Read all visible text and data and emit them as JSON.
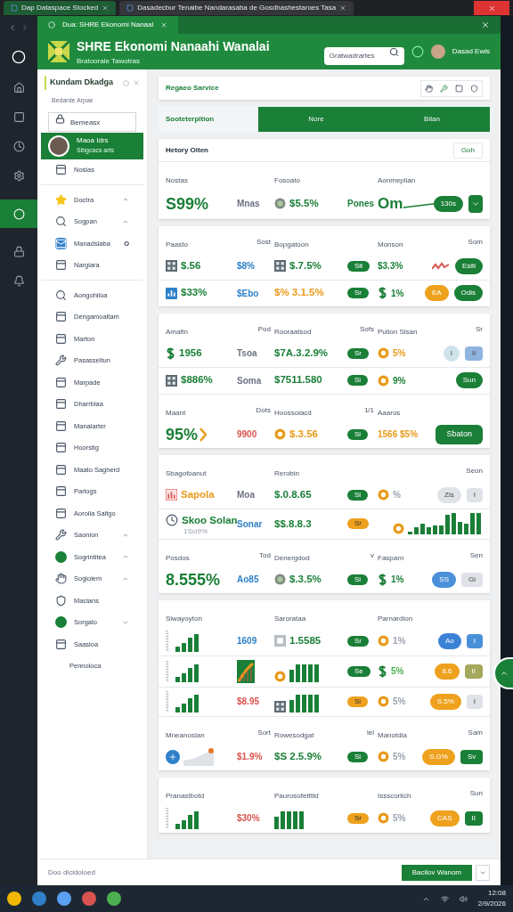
{
  "browser": {
    "tabs": [
      {
        "label": "Dap Dataspace Stocked",
        "selected": true
      },
      {
        "label": "Dasadecbur Tenaibe Nandarasaba de Gosdhashestaroes Tasa",
        "selected": false
      }
    ]
  },
  "window": {
    "tab": "Dua: SHRE Ekonomi Nanaal",
    "title": "SHRE Ekonomi Nanaahi Wanalai",
    "subtitle": "Bratoorale Tawotras",
    "search": {
      "placeholder": "Gratwadrartes"
    },
    "user": "Dasad Ewis"
  },
  "sidebar": {
    "title": "Kundam Dkadga",
    "section": "Bedarde Arpae",
    "search": {
      "value": "Bemeasx"
    },
    "profile": {
      "name": "Maoa Idrs",
      "detail": "Sibgcacs arts",
      "selected": true
    },
    "items": [
      {
        "kind": "panel",
        "label": "Nosias"
      },
      {
        "kind": "divider"
      },
      {
        "kind": "star",
        "label": "Doctra",
        "expanded": true
      },
      {
        "kind": "search",
        "label": "Sogpan",
        "expanded": true
      },
      {
        "kind": "mail",
        "label": "Manadsiaba",
        "badge": "O"
      },
      {
        "kind": "panel",
        "label": "Nargiara"
      },
      {
        "kind": "divider"
      },
      {
        "kind": "search",
        "label": "Aongohiloa"
      },
      {
        "kind": "panel",
        "label": "Dengamoaltam"
      },
      {
        "kind": "panel",
        "label": "Marton"
      },
      {
        "kind": "tool",
        "label": "Pasasseltun"
      },
      {
        "kind": "panel",
        "label": "Marpade"
      },
      {
        "kind": "panel",
        "label": "Dharrblaa"
      },
      {
        "kind": "panel",
        "label": "Manalarter"
      },
      {
        "kind": "panel",
        "label": "Hoorstig"
      },
      {
        "kind": "panel",
        "label": "Maato Sagherd"
      },
      {
        "kind": "panel",
        "label": "Parlogs"
      },
      {
        "kind": "panel",
        "label": "Aoroila Saltgo"
      },
      {
        "kind": "tool",
        "label": "Saonion",
        "expanded": true
      },
      {
        "kind": "dot",
        "label": "Sogrintitea",
        "expanded": true
      },
      {
        "kind": "hand",
        "label": "Sogioiem",
        "expanded": true
      },
      {
        "kind": "shield",
        "label": "Macians"
      },
      {
        "kind": "dot",
        "label": "Sorgalo",
        "expanded": false
      },
      {
        "kind": "panel",
        "label": "Saasloa"
      },
      {
        "kind": "plain",
        "label": "Pennoloca"
      }
    ]
  },
  "toolbar": {
    "title": "Regaeo Sarvice"
  },
  "tabs": [
    {
      "label": "Sooteterpition",
      "selected": true
    },
    {
      "label": "Nore",
      "selected": false
    },
    {
      "label": "Bilan",
      "selected": false
    }
  ],
  "cards": [
    {
      "title": "Hetory Oiten",
      "action": "Goh",
      "groups": [
        {
          "headers": {
            "column_1": "Nostas",
            "column_3": "Fosoato",
            "column_5": "Aonmeplian"
          },
          "rows": [
            [
              {
                "kind": "headline",
                "text": "S99%",
                "color": "#1a7f37"
              },
              {
                "kind": "value",
                "text": "Mnas",
                "color": "#6b7280"
              },
              {
                "kind": "value",
                "text": "$5.5%",
                "color": "#1a7f37",
                "marker": {
                  "kind": "coin"
                }
              },
              {
                "kind": "value",
                "text": "Pones",
                "color": "#1a7f37"
              },
              {
                "kind": "trend",
                "text": "Om",
                "color": "#1a7f37"
              },
              {
                "kind": "pills",
                "items": [
                  {
                    "kind": "pill",
                    "text": "130s",
                    "color": "#1a7f37"
                  },
                  {
                    "kind": "menu"
                  }
                ]
              }
            ]
          ]
        }
      ]
    },
    {
      "groups": [
        {
          "headers": {
            "column_1": "Paasto",
            "column_2": "Sost",
            "column_3": "Bopgatoon",
            "column_5": "Monson",
            "column_6": "Som"
          },
          "rows": [
            [
              {
                "kind": "value",
                "text": "$.56",
                "color": "#1a7f37",
                "marker": {
                  "kind": "tile"
                }
              },
              {
                "kind": "value",
                "text": "$8%",
                "color": "#2f80c9"
              },
              {
                "kind": "value",
                "text": "$.7.5%",
                "color": "#1a7f37",
                "marker": {
                  "kind": "tile"
                }
              },
              {
                "kind": "pill",
                "text": "Sit",
                "color": "#1a7f37"
              },
              {
                "kind": "value",
                "text": "$3.3%",
                "color": "#1a7f37"
              },
              {
                "kind": "pills",
                "items": [
                  {
                    "kind": "squiggle"
                  },
                  {
                    "kind": "pill",
                    "text": "Esiti",
                    "color": "#1a7f37"
                  }
                ]
              }
            ],
            [
              {
                "kind": "value",
                "text": "$33%",
                "color": "#1a7f37",
                "marker": {
                  "kind": "blue-tile"
                }
              },
              {
                "kind": "value",
                "text": "$Ebo",
                "color": "#2f80c9"
              },
              {
                "kind": "value",
                "text": "$% 3.1.5%",
                "color": "#e89a1a"
              },
              {
                "kind": "pill",
                "text": "Sr",
                "color": "#1a7f37"
              },
              {
                "kind": "value",
                "text": "1%",
                "color": "#1a7f37",
                "marker": {
                  "kind": "dollar"
                }
              },
              {
                "kind": "pills",
                "items": [
                  {
                    "kind": "pill",
                    "text": "EA",
                    "color": "#eea11d"
                  },
                  {
                    "kind": "pill",
                    "text": "Odis",
                    "color": "#1a7f37"
                  }
                ]
              }
            ]
          ]
        }
      ]
    },
    {
      "groups": [
        {
          "headers": {
            "column_1": "Amafin",
            "column_2": "Pod",
            "column_3": "Rooraatsod",
            "column_4": "Sofs",
            "column_5": "Pullon Sisan",
            "column_6": "Sr"
          },
          "rows": [
            [
              {
                "kind": "value",
                "text": "1956",
                "color": "#1a7f37",
                "marker": {
                  "kind": "dollar"
                }
              },
              {
                "kind": "value",
                "text": "Tsoa",
                "color": "#6b7280"
              },
              {
                "kind": "value",
                "text": "$7A.3.2.9%",
                "color": "#1a7f37"
              },
              {
                "kind": "pill",
                "text": "Sr",
                "color": "#1a7f37"
              },
              {
                "kind": "value",
                "text": "5%",
                "color": "#e89a1a",
                "marker": {
                  "kind": "coin-orange"
                }
              },
              {
                "kind": "pills",
                "items": [
                  {
                    "kind": "pill",
                    "text": "I",
                    "color": "#cfe3ea"
                  },
                  {
                    "kind": "tag",
                    "text": "Ii",
                    "color": "#8fb4e0"
                  }
                ]
              }
            ],
            [
              {
                "kind": "value",
                "text": "$886%",
                "color": "#1a7f37",
                "marker": {
                  "kind": "tile"
                }
              },
              {
                "kind": "value",
                "text": "Soma",
                "color": "#6b7280"
              },
              {
                "kind": "value",
                "text": "$7511.580",
                "color": "#1a7f37"
              },
              {
                "kind": "pill",
                "text": "Si",
                "color": "#1a7f37"
              },
              {
                "kind": "value",
                "text": "9%",
                "color": "#1a7f37",
                "marker": {
                  "kind": "coin-orange"
                }
              },
              {
                "kind": "pills",
                "items": [
                  {
                    "kind": "pill",
                    "text": "Sun",
                    "color": "#1a7f37"
                  }
                ]
              }
            ]
          ]
        },
        {
          "headers": {
            "column_1": "Maant",
            "column_2": "Dots",
            "column_3": "Hoossoiacd",
            "column_4": "1/1",
            "column_5": "Aaaros"
          },
          "rows": [
            [
              {
                "kind": "headline",
                "text": "95%",
                "color": "#1a7f37",
                "marker": {
                  "kind": "chevron"
                }
              },
              {
                "kind": "value",
                "text": "9900",
                "color": "#d9534f"
              },
              {
                "kind": "value",
                "text": "$.3.56",
                "color": "#e89a1a",
                "marker": {
                  "kind": "coin-orange"
                }
              },
              {
                "kind": "pill",
                "text": "Si",
                "color": "#1a7f37"
              },
              {
                "kind": "value",
                "text": "1566 $5%",
                "color": "#e89a1a"
              },
              {
                "kind": "pills",
                "items": [
                  {
                    "kind": "button",
                    "text": "Sbaton",
                    "color": "#1a7f37"
                  }
                ]
              }
            ]
          ]
        }
      ]
    },
    {
      "groups": [
        {
          "headers": {
            "column_1": "Sbagofoanut",
            "column_3": "Rerobin",
            "column_6": "Seon"
          },
          "rows": [
            [
              {
                "kind": "value",
                "text": "Sapola",
                "color": "#e89a1a",
                "marker": {
                  "kind": "red-tile"
                }
              },
              {
                "kind": "value",
                "text": "Moa",
                "color": "#6b7280"
              },
              {
                "kind": "value",
                "text": "$.0.8.65",
                "color": "#1a7f37"
              },
              {
                "kind": "pill",
                "text": "Si",
                "color": "#1a7f37"
              },
              {
                "kind": "value",
                "text": "%",
                "color": "#9ca3af",
                "marker": {
                  "kind": "coin-orange"
                }
              },
              {
                "kind": "pills",
                "items": [
                  {
                    "kind": "pill",
                    "text": "Zis",
                    "color": "#dfe3e8"
                  },
                  {
                    "kind": "tag",
                    "text": "I",
                    "color": "#dfe3e8"
                  }
                ]
              }
            ],
            [
              {
                "kind": "value",
                "text": "Skoo Solan",
                "detail": "1Sci9%",
                "color": "#1a7f37",
                "marker": {
                  "kind": "clock"
                }
              },
              {
                "kind": "value",
                "text": "Sonar",
                "color": "#2f80c9"
              },
              {
                "kind": "value",
                "text": "$$.8.8.3",
                "color": "#1a7f37"
              },
              {
                "kind": "pill",
                "text": "Sr",
                "color": "#eea11d"
              },
              {
                "kind": "bars",
                "marker": {
                  "kind": "coin-orange"
                }
              }
            ]
          ]
        },
        {
          "headers": {
            "column_1": "Posdos",
            "column_2": "Tod",
            "column_3": "Denergdod",
            "column_4": "v",
            "column_5": "Fasparn",
            "column_6": "Sen"
          },
          "rows": [
            [
              {
                "kind": "headline",
                "text": "8.555%",
                "color": "#1a7f37"
              },
              {
                "kind": "value",
                "text": "Ao85",
                "color": "#2f80c9"
              },
              {
                "kind": "value",
                "text": "$.3.5%",
                "color": "#1a7f37",
                "marker": {
                  "kind": "coin"
                }
              },
              {
                "kind": "pill",
                "text": "Si",
                "color": "#1a7f37"
              },
              {
                "kind": "value",
                "text": "1%",
                "color": "#1a7f37",
                "marker": {
                  "kind": "dollar"
                }
              },
              {
                "kind": "pills",
                "items": [
                  {
                    "kind": "pill",
                    "text": "SS",
                    "color": "#4a90d9"
                  },
                  {
                    "kind": "tag",
                    "text": "Gi",
                    "color": "#dfe3e8"
                  }
                ]
              }
            ]
          ]
        }
      ]
    },
    {
      "groups": [
        {
          "headers": {
            "column_1": "Siwayoyton",
            "column_3": "Sarorataa",
            "column_5": "Parnardion"
          },
          "rows": [
            [
              {
                "kind": "axis-bars"
              },
              {
                "kind": "value",
                "text": "1609",
                "color": "#2f80c9"
              },
              {
                "kind": "value",
                "text": "1.5585",
                "color": "#1a7f37",
                "marker": {
                  "kind": "grey-tile"
                }
              },
              {
                "kind": "pill",
                "text": "Sr",
                "color": "#1a7f37"
              },
              {
                "kind": "value",
                "text": "1%",
                "color": "#9ca3af",
                "marker": {
                  "kind": "coin-orange"
                }
              },
              {
                "kind": "pills",
                "items": [
                  {
                    "kind": "pill",
                    "text": "Ao",
                    "color": "#3b82d6"
                  },
                  {
                    "kind": "tag",
                    "text": "I",
                    "color": "#4a90d9"
                  }
                ]
              }
            ],
            [
              {
                "kind": "axis-bars"
              },
              {
                "kind": "chart-tile"
              },
              {
                "kind": "bars",
                "marker": {
                  "kind": "coin-orange"
                }
              },
              {
                "kind": "pill",
                "text": "Se",
                "color": "#1a7f37"
              },
              {
                "kind": "value",
                "text": "5%",
                "color": "#4caf50",
                "marker": {
                  "kind": "dollar"
                }
              },
              {
                "kind": "pills",
                "items": [
                  {
                    "kind": "pill",
                    "text": "8.6",
                    "color": "#eea11d"
                  },
                  {
                    "kind": "tag",
                    "text": "II",
                    "color": "#a3a85a"
                  }
                ]
              }
            ],
            [
              {
                "kind": "axis-bars"
              },
              {
                "kind": "value",
                "text": "$8.95",
                "color": "#d9534f"
              },
              {
                "kind": "bars",
                "marker": {
                  "kind": "tile"
                }
              },
              {
                "kind": "pill",
                "text": "Si",
                "color": "#eea11d"
              },
              {
                "kind": "value",
                "text": "5%",
                "color": "#9ca3af",
                "marker": {
                  "kind": "coin-orange"
                }
              },
              {
                "kind": "pills",
                "items": [
                  {
                    "kind": "pill",
                    "text": "S.5%",
                    "color": "#eea11d"
                  },
                  {
                    "kind": "tag",
                    "text": "I",
                    "color": "#dfe3e8"
                  }
                ]
              }
            ]
          ]
        },
        {
          "headers": {
            "column_1": "Mneanoslan",
            "column_2": "Sort",
            "column_3": "Rowesodgat",
            "column_4": "lel",
            "column_5": "Manotdia",
            "column_6": "Sam"
          },
          "rows": [
            [
              {
                "kind": "area"
              },
              {
                "kind": "value",
                "text": "$1.9%",
                "color": "#d9534f"
              },
              {
                "kind": "value",
                "text": "$S 2.5.9%",
                "color": "#1a7f37"
              },
              {
                "kind": "pill",
                "text": "Si",
                "color": "#1a7f37"
              },
              {
                "kind": "value",
                "text": "5%",
                "color": "#9ca3af",
                "marker": {
                  "kind": "coin-orange"
                }
              },
              {
                "kind": "pills",
                "items": [
                  {
                    "kind": "pill",
                    "text": "S.G%",
                    "color": "#eea11d"
                  },
                  {
                    "kind": "tag",
                    "text": "Sv",
                    "color": "#1a7f37"
                  }
                ]
              }
            ]
          ]
        }
      ]
    },
    {
      "groups": [
        {
          "headers": {
            "column_1": "Pranastbotd",
            "column_3": "Paurosofettttd",
            "column_5": "Issscorlich",
            "column_6": "Sun"
          },
          "rows": [
            [
              {
                "kind": "axis-bars"
              },
              {
                "kind": "value",
                "text": "$30%",
                "color": "#d9534f"
              },
              {
                "kind": "bars"
              },
              {
                "kind": "pill",
                "text": "Sr",
                "color": "#eea11d"
              },
              {
                "kind": "value",
                "text": "5%",
                "color": "#9ca3af",
                "marker": {
                  "kind": "coin-orange"
                }
              },
              {
                "kind": "pills",
                "items": [
                  {
                    "kind": "pill",
                    "text": "CAS",
                    "color": "#eea11d"
                  },
                  {
                    "kind": "tag",
                    "text": "II",
                    "color": "#1a7f37"
                  }
                ]
              }
            ]
          ]
        }
      ]
    }
  ],
  "footer": {
    "status": "Doo dicidoloed",
    "button": "Bacilov Wanom"
  },
  "taskbar": {
    "time": "12:08",
    "date": "2/9/2026"
  }
}
